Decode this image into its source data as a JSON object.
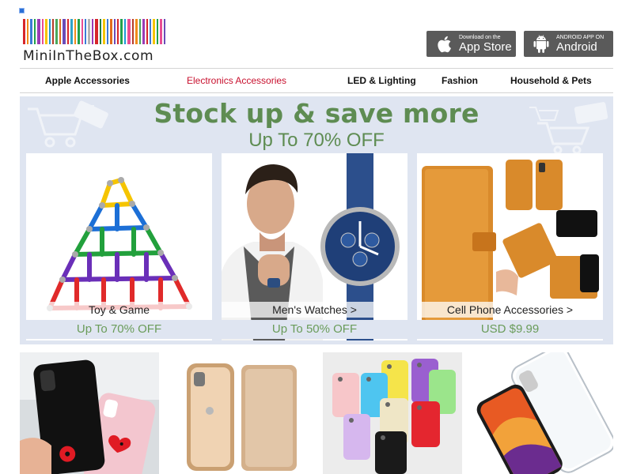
{
  "logo": {
    "text": "MiniInTheBox.com",
    "bar_colors": [
      "#d7262a",
      "#f28c1b",
      "#3b7bd6",
      "#21a14a",
      "#9a3bb5",
      "#e94d93",
      "#f5c400",
      "#1c9ad6",
      "#b43b2a",
      "#4aa85c",
      "#e26b1d",
      "#6b4bb8",
      "#d7262a",
      "#2fa3c8",
      "#f28c1b",
      "#21a14a",
      "#e94d93",
      "#3b7bd6",
      "#b5b5b5",
      "#9a3bb5",
      "#d7262a",
      "#1f7f3f",
      "#f5c400",
      "#3b7bd6",
      "#e26b1d",
      "#6b4bb8",
      "#d7262a",
      "#21a14a",
      "#1c9ad6",
      "#e94d93",
      "#b43b2a",
      "#f28c1b",
      "#4aa85c",
      "#9a3bb5",
      "#d7262a",
      "#3b7bd6",
      "#f5c400",
      "#21a14a",
      "#e94d93",
      "#6b4bb8"
    ]
  },
  "badges": {
    "ios": {
      "small": "Download on the",
      "big": "App Store",
      "icon": "apple-icon"
    },
    "android": {
      "small": "ANDROID APP ON",
      "big": "Android",
      "icon": "android-icon"
    }
  },
  "nav": {
    "items": [
      {
        "label": "Apple Accessories",
        "active": false
      },
      {
        "label": "Electronics Accessories",
        "active": true
      },
      {
        "label": "LED & Lighting",
        "active": false
      },
      {
        "label": "Fashion",
        "active": false
      },
      {
        "label": "Household & Pets",
        "active": false
      }
    ]
  },
  "promo": {
    "title": "Stock up & save more",
    "subtitle": "Up To 70% OFF",
    "cards": [
      {
        "caption": "Toy & Game",
        "offer": "Up To 70% OFF"
      },
      {
        "caption": "Men's Watches >",
        "offer": "Up To 50% OFF"
      },
      {
        "caption": "Cell Phone Accessories >",
        "offer": "USD $9.99"
      }
    ]
  },
  "colors": {
    "accent_red": "#c8102e",
    "promo_green": "#5e8c52",
    "promo_bg": "#dfe5f1"
  }
}
